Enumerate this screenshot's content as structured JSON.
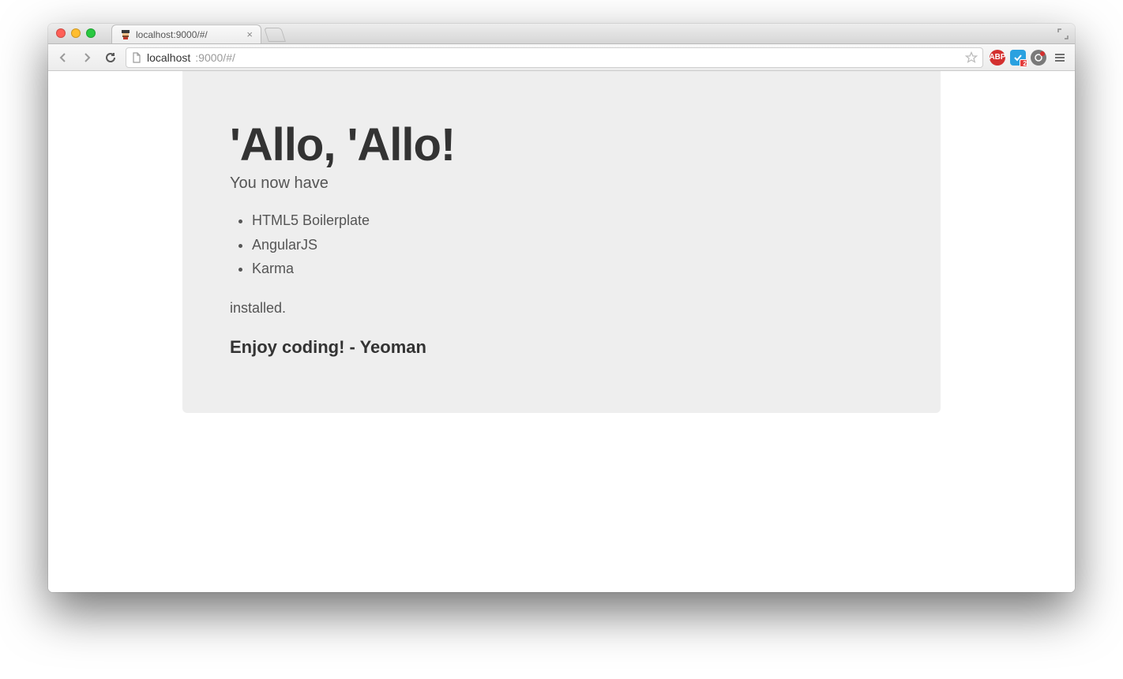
{
  "browser": {
    "tab": {
      "title": "localhost:9000/#/",
      "favicon_name": "yeoman-icon"
    },
    "url": {
      "host": "localhost",
      "rest": ":9000/#/"
    },
    "extensions": {
      "abp_label": "ABP",
      "blue_badge": "2"
    }
  },
  "page": {
    "heading": "'Allo, 'Allo!",
    "lead": "You now have",
    "items": [
      "HTML5 Boilerplate",
      "AngularJS",
      "Karma"
    ],
    "installed": "installed.",
    "footer": "Enjoy coding! - Yeoman"
  }
}
